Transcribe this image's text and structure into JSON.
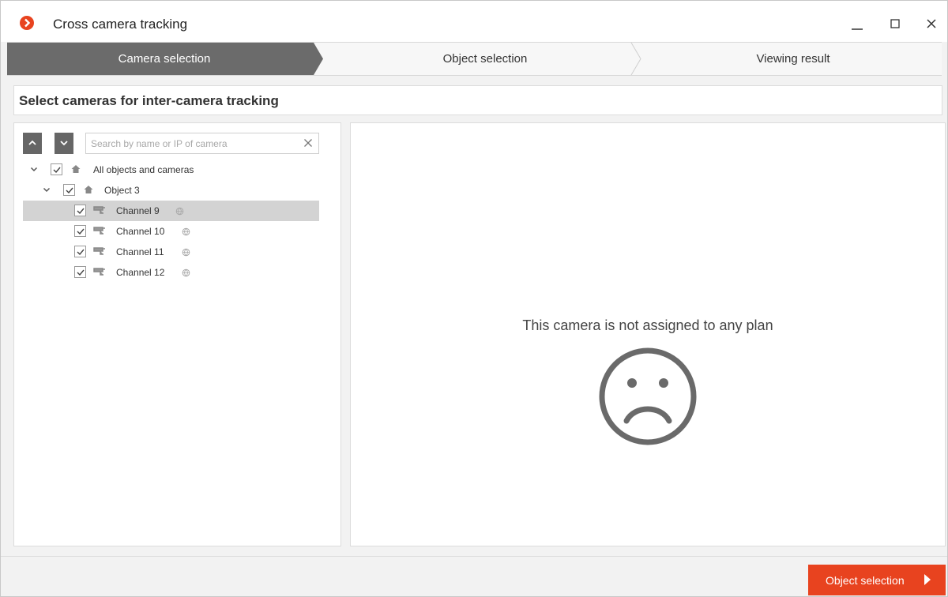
{
  "window": {
    "title": "Cross camera tracking",
    "accent_color": "#e8431f"
  },
  "steps": [
    {
      "label": "Camera selection",
      "active": true
    },
    {
      "label": "Object selection",
      "active": false
    },
    {
      "label": "Viewing result",
      "active": false
    }
  ],
  "heading": "Select cameras for inter-camera tracking",
  "search": {
    "placeholder": "Search by name or IP of camera",
    "value": ""
  },
  "tree": {
    "root": {
      "label": "All objects and cameras",
      "checked": true,
      "expanded": true
    },
    "object": {
      "label": "Object 3",
      "checked": true,
      "expanded": true
    },
    "channels": [
      {
        "label": "Channel 9",
        "checked": true,
        "selected": true
      },
      {
        "label": "Channel 10",
        "checked": true,
        "selected": false
      },
      {
        "label": "Channel 11",
        "checked": true,
        "selected": false
      },
      {
        "label": "Channel 12",
        "checked": true,
        "selected": false
      }
    ]
  },
  "plan_view": {
    "message": "This camera is not assigned to any plan",
    "icon": "sad-face-icon"
  },
  "footer": {
    "next_label": "Object selection"
  }
}
